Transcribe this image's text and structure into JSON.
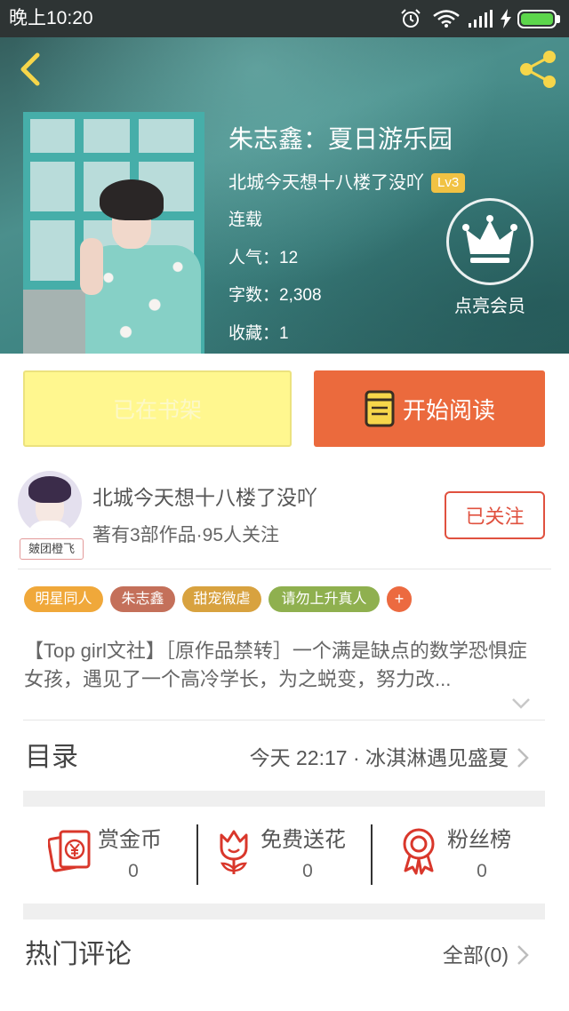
{
  "status_bar": {
    "time": "晚上10:20",
    "icons": [
      "alarm-icon",
      "wifi-icon",
      "signal-icon",
      "charging-icon",
      "battery-icon"
    ]
  },
  "header": {
    "back_icon": "back-arrow-icon",
    "share_icon": "share-icon"
  },
  "book": {
    "title": "朱志鑫：夏日游乐园",
    "author": "北城今天想十八楼了没吖",
    "level": "Lv3",
    "status": "连载",
    "popularity": "人气：12",
    "word_count": "字数：2,308",
    "favorites": "收藏：1",
    "vip_label": "点亮会员",
    "vip_icon": "crown-icon"
  },
  "actions": {
    "shelf_label": "已在书架",
    "read_label": "开始阅读",
    "read_icon": "book-icon"
  },
  "author_card": {
    "name": "北城今天想十八楼了没吖",
    "stats": "著有3部作品·95人关注",
    "follow_label": "已关注",
    "avatar_caption": "皴团橙飞"
  },
  "tags": [
    {
      "label": "明星同人",
      "color": "#f0a83a"
    },
    {
      "label": "朱志鑫",
      "color": "#c4705a"
    },
    {
      "label": "甜宠微虐",
      "color": "#d8a23f"
    },
    {
      "label": "请勿上升真人",
      "color": "#8fb04f"
    }
  ],
  "more_tag": {
    "label": "+",
    "color": "#ec6a40"
  },
  "description": "【Top girl文社】［原作品禁转］一个满是缺点的数学恐惧症女孩，遇见了一个高冷学长，为之蜕变，努力改...",
  "catalog": {
    "label": "目录",
    "latest": "今天 22:17 · 冰淇淋遇见盛夏"
  },
  "rewards": [
    {
      "label": "赏金币",
      "count": "0",
      "icon": "red-envelope-icon"
    },
    {
      "label": "免费送花",
      "count": "0",
      "icon": "flower-icon"
    },
    {
      "label": "粉丝榜",
      "count": "0",
      "icon": "medal-icon"
    }
  ],
  "comments": {
    "label": "热门评论",
    "all_label": "全部(0)"
  },
  "colors": {
    "accent_orange": "#eb6a3d",
    "shelf_yellow": "#fff78f",
    "follow_red": "#e0513f",
    "icon_yellow": "#f6d64a",
    "reward_red": "#d9372b",
    "header_teal": "#3f8583"
  }
}
